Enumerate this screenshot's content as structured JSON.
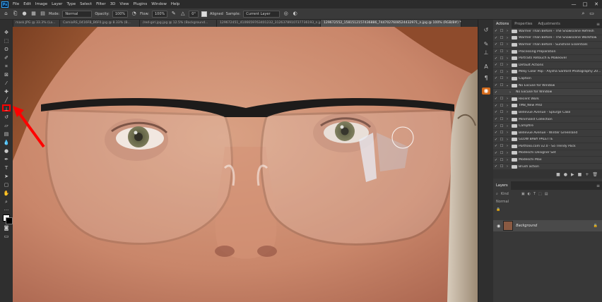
{
  "menubar": {
    "logo": "Ps",
    "items": [
      "File",
      "Edit",
      "Image",
      "Layer",
      "Type",
      "Select",
      "Filter",
      "3D",
      "View",
      "Plugins",
      "Window",
      "Help"
    ],
    "window_controls": [
      "—",
      "□",
      "✕"
    ]
  },
  "options_bar": {
    "mode_label": "Mode:",
    "mode_value": "Normal",
    "opacity_label": "Opacity:",
    "opacity_value": "100%",
    "flow_label": "Flow:",
    "flow_value": "100%",
    "angle_value": "0°",
    "aligned_label": "Aligned",
    "sample_label": "Sample:",
    "sample_value": "Current Layer"
  },
  "doc_tabs": [
    "mask.JPG @ 33.3% (La...",
    "CamiaRS_0416FB_B6F0.jpg @ 8.33% (B...",
    "/red-girl.jpg.jpg @ 12.5% (Background...",
    "129672451_4106659763401232_3126378910737736193_n.jpg",
    "129672552_1581512157436886_7447027608524432971_n.jpg @ 100% (RGB/8#) *"
  ],
  "active_tab_index": 4,
  "tools": [
    "move-tool",
    "artboard-tool",
    "lasso-tool",
    "quick-select-tool",
    "crop-tool",
    "frame-tool",
    "eyedropper-tool",
    "healing-brush-tool",
    "brush-tool",
    "clone-stamp-tool",
    "history-brush-tool",
    "eraser-tool",
    "gradient-tool",
    "blur-tool",
    "dodge-tool",
    "pen-tool",
    "type-tool",
    "path-select-tool",
    "rectangle-tool",
    "hand-tool",
    "zoom-tool"
  ],
  "highlighted_tool": "clone-stamp-tool",
  "actions_panel": {
    "tabs": [
      "Actions",
      "Properties",
      "Adjustments"
    ],
    "menu": "≡",
    "items": [
      "Warmer Than Before - The Snowscene Refresh",
      "Warmer Than Before - The Snowscene Workflow",
      "Warmer Than Before - Sunshine Essentials",
      "Processing Preparation",
      "Portraits Retouch & Makeover",
      "Default Actions",
      "Milky Color Pop - Alysha Sanford Photography 20...",
      "Caption",
      "No Excuse for Window",
      "No Excuse for Window",
      "Recent Work",
      "TMB_New Prez",
      "Bellevue Avenue - Splurge Cake",
      "Minimalist Collection",
      "Campfire",
      "Bellevue Avenue - Winter Greenland",
      "GLOW BABY PALETTE",
      "Portfolio.com v2.0 - So Trendy Pack",
      "Modeschi Designer Set",
      "Modeschi Max",
      "Brush action"
    ],
    "expanded_index": 8,
    "footer_icons": [
      "■",
      "●",
      "▶",
      "■",
      "+",
      "🗑"
    ]
  },
  "layers_panel": {
    "tab": "Layers",
    "menu": "≡",
    "kind_label": "Kind",
    "mode_value": "Normal",
    "layer_name": "Background"
  },
  "strip_icons": [
    "history-icon",
    "brush-settings-icon",
    "clone-source-icon",
    "character-icon",
    "paragraph-icon",
    "libraries-icon"
  ],
  "colors": {
    "accent_red": "#ff0000",
    "panel_bg": "#383838",
    "toolbar_bg": "#2f2f2f"
  }
}
